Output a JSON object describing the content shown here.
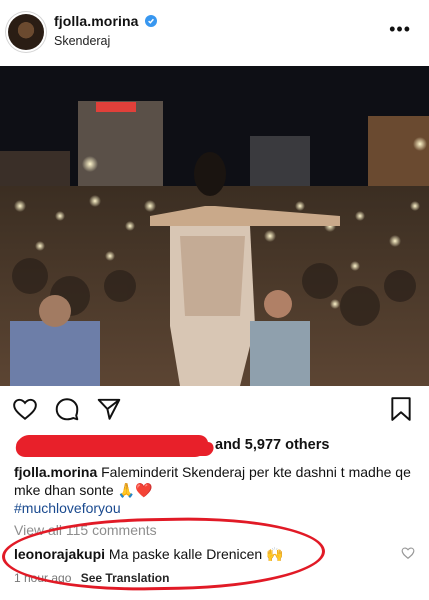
{
  "post": {
    "username": "fjolla.morina",
    "location": "Skenderaj",
    "more_icon": "ellipsis-icon",
    "verified_icon": "verified-badge-icon"
  },
  "likes": {
    "text": "and 5,977 others"
  },
  "caption": {
    "username": "fjolla.morina",
    "text": "Faleminderit Skenderaj per kte dashni t madhe qe mke dhan sonte",
    "emojis": "🙏❤️",
    "hashtag": "#muchloveforyou"
  },
  "comments": {
    "view_all": "View all 115 comments",
    "items": [
      {
        "username": "leonorajakupi",
        "text": "Ma paske kalle Drenicen",
        "emoji": "🙌",
        "time": "1 hour ago",
        "see_translation": "See Translation"
      }
    ]
  },
  "colors": {
    "annotation_red": "#e11a26",
    "verified_blue": "#3897f0",
    "hashtag_blue": "#1a4a8f"
  }
}
